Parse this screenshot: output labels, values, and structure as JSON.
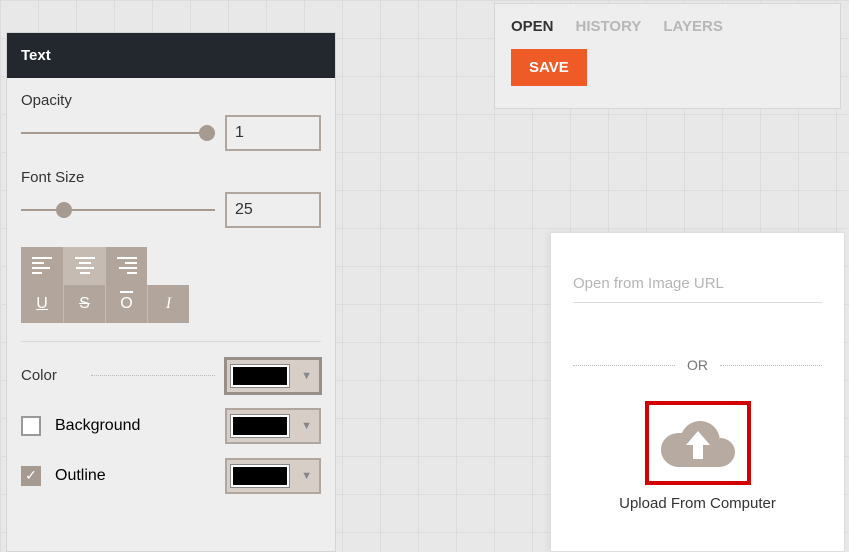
{
  "panel": {
    "title": "Text",
    "opacity": {
      "label": "Opacity",
      "value": "1",
      "percent": 100
    },
    "fontsize": {
      "label": "Font Size",
      "value": "25",
      "percent": 15
    },
    "style": {
      "u": "U",
      "s": "S",
      "o": "O",
      "i": "I"
    },
    "color": {
      "label": "Color",
      "value": "#000000"
    },
    "background": {
      "label": "Background",
      "checked": false,
      "value": "#000000"
    },
    "outline": {
      "label": "Outline",
      "checked": true,
      "value": "#000000"
    }
  },
  "topPanel": {
    "tabs": [
      "OPEN",
      "HISTORY",
      "LAYERS"
    ],
    "activeTab": 0,
    "save": "SAVE"
  },
  "openPanel": {
    "urlPlaceholder": "Open from Image URL",
    "or": "OR",
    "uploadLabel": "Upload From Computer"
  }
}
